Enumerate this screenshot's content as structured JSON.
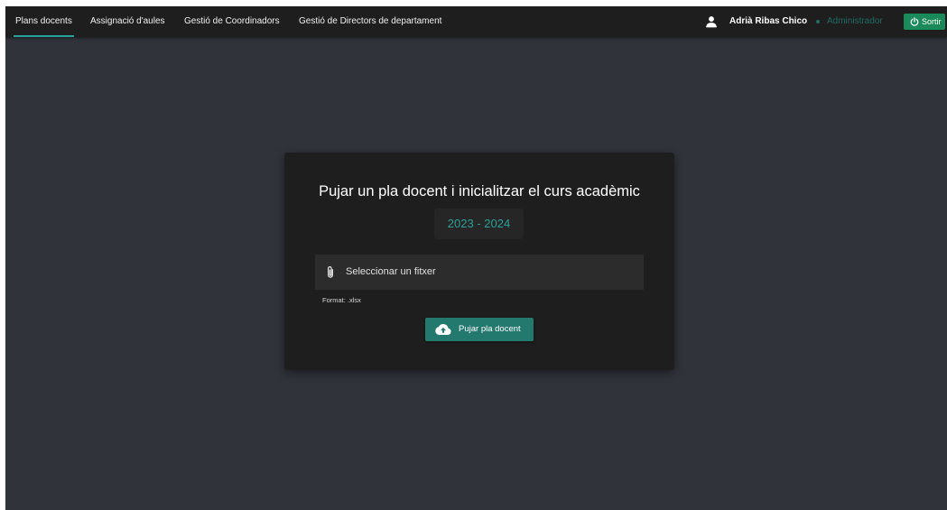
{
  "navbar": {
    "tabs": [
      {
        "label": "Plans docents",
        "active": true
      },
      {
        "label": "Assignació d'aules",
        "active": false
      },
      {
        "label": "Gestió de Coordinadors",
        "active": false
      },
      {
        "label": "Gestió de Directors de departament",
        "active": false
      }
    ],
    "user": {
      "icon": "person-icon",
      "name": "Adrià Ribas Chico",
      "role": "Administrador"
    },
    "logout": {
      "icon": "power-icon",
      "label": "Sortir"
    }
  },
  "upload_card": {
    "title": "Pujar un pla docent i inicialitzar el curs acadèmic",
    "academic_year": "2023 - 2024",
    "file_input": {
      "icon": "paperclip-icon",
      "placeholder": "Seleccionar un fitxer",
      "value": ""
    },
    "format_hint": "Format: .xlsx",
    "submit": {
      "icon": "cloud-upload-icon",
      "label": "Pujar pla docent"
    }
  },
  "colors": {
    "page_background": "#30333a",
    "navbar_background": "#1e1e1e",
    "card_background": "#1e1e1e",
    "accent_teal": "#2aa198",
    "button_teal": "#24796f",
    "logout_green": "#1a8a5a"
  }
}
